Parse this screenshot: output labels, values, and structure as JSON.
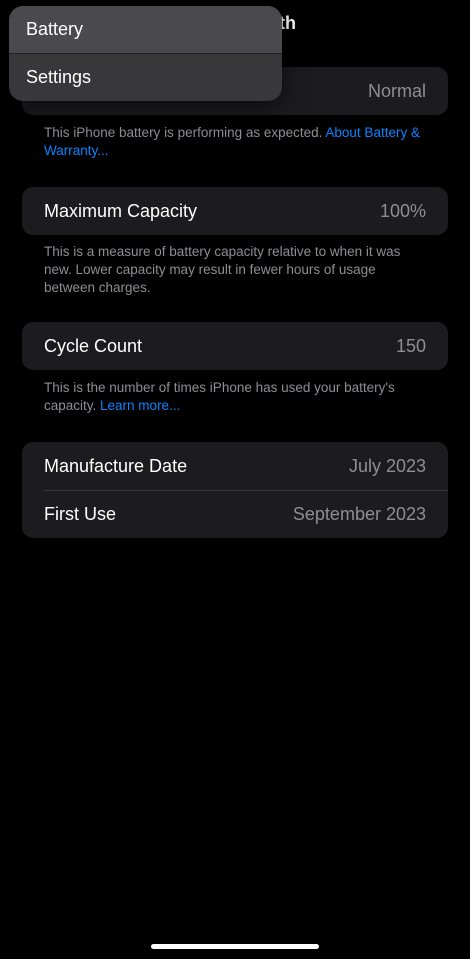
{
  "header": {
    "title_fragment": "th"
  },
  "back_menu": {
    "items": [
      {
        "label": "Battery"
      },
      {
        "label": "Settings"
      }
    ]
  },
  "performance": {
    "value": "Normal",
    "footnote": "This iPhone battery is performing as expected. ",
    "link": "About Battery & Warranty..."
  },
  "max_capacity": {
    "label": "Maximum Capacity",
    "value": "100%",
    "footnote": "This is a measure of battery capacity relative to when it was new. Lower capacity may result in fewer hours of usage between charges."
  },
  "cycle_count": {
    "label": "Cycle Count",
    "value": "150",
    "footnote": "This is the number of times iPhone has used your battery's capacity. ",
    "link": "Learn more..."
  },
  "dates": {
    "manufacture_label": "Manufacture Date",
    "manufacture_value": "July 2023",
    "first_use_label": "First Use",
    "first_use_value": "September 2023"
  },
  "colors": {
    "background": "#000000",
    "group_background": "#1c1c1e",
    "secondary_text": "#8e8e93",
    "link": "#0a84ff"
  }
}
